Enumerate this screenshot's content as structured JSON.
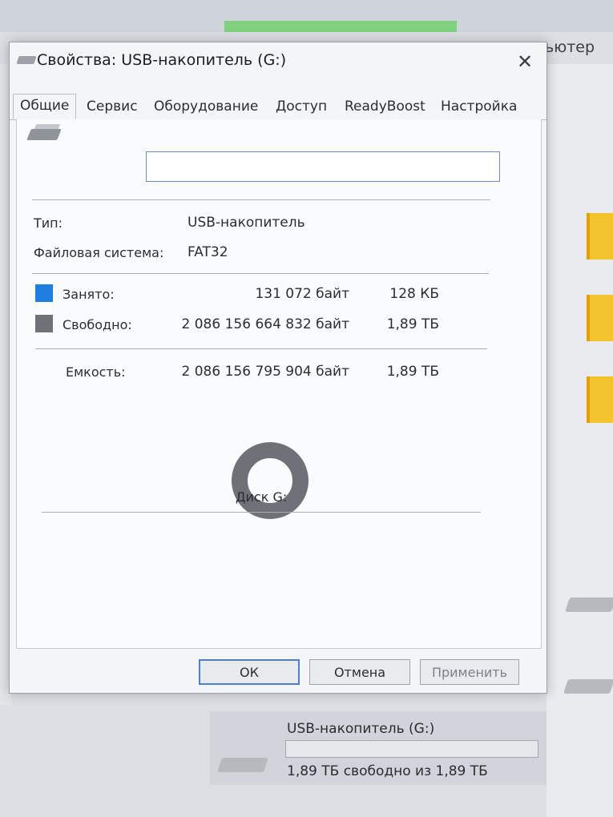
{
  "background": {
    "window_title_fragment": "ьютер",
    "drive_tile": {
      "name": "USB-накопитель (G:)",
      "free_summary": "1,89 ТБ свободно из 1,89 ТБ"
    }
  },
  "dialog": {
    "title": "Свойства: USB-накопитель (G:)",
    "close_icon": "close-icon",
    "tabs": [
      "Общие",
      "Сервис",
      "Оборудование",
      "Доступ",
      "ReadyBoost",
      "Настройка"
    ],
    "active_tab": "Общие",
    "name_field": {
      "value": "",
      "placeholder": ""
    },
    "type_label": "Тип:",
    "type_value": "USB-накопитель",
    "fs_label": "Файловая система:",
    "fs_value": "FAT32",
    "used": {
      "label": "Занято:",
      "bytes": "131 072 байт",
      "size": "128 КБ",
      "color": "#1f7fe0"
    },
    "free": {
      "label": "Свободно:",
      "bytes": "2 086 156 664 832 байт",
      "size": "1,89 ТБ",
      "color": "#6e7177"
    },
    "capacity": {
      "label": "Емкость:",
      "bytes": "2 086 156 795 904 байт",
      "size": "1,89 ТБ"
    },
    "disk_label": "Диск G:",
    "used_fraction": 1e-07,
    "buttons": {
      "ok": "ОК",
      "cancel": "Отмена",
      "apply": "Применить"
    }
  }
}
